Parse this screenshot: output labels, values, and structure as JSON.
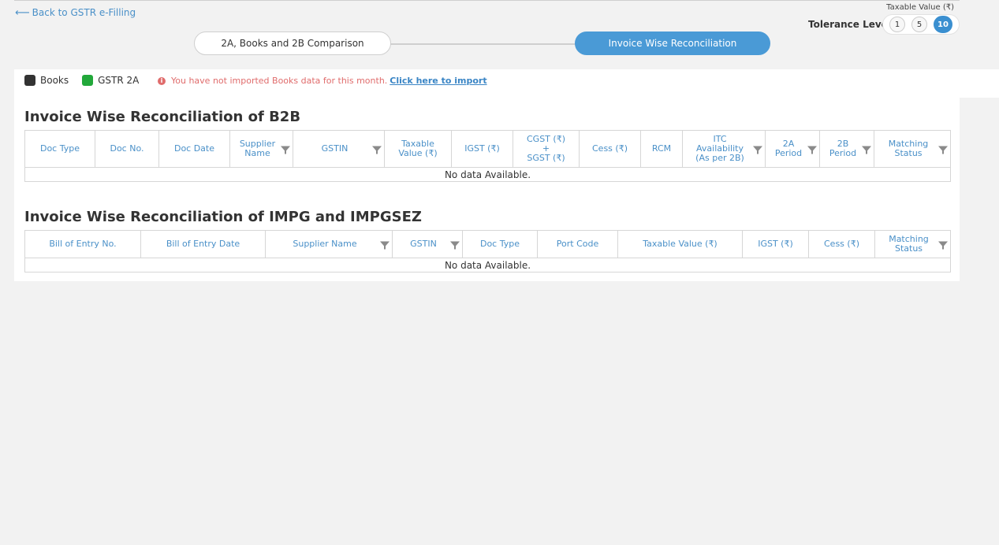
{
  "nav": {
    "back_label": "Back to GSTR e-Filling"
  },
  "tolerance": {
    "caption": "Taxable Value (₹)",
    "label": "Tolerance Level",
    "options": [
      "1",
      "5",
      "10"
    ],
    "selected": "10"
  },
  "steps": [
    {
      "label": "2A, Books and 2B Comparison",
      "active": false
    },
    {
      "label": "Invoice Wise Reconciliation",
      "active": true
    }
  ],
  "legend": {
    "books": {
      "label": "Books",
      "color": "#333333"
    },
    "gstr2a": {
      "label": "GSTR 2A",
      "color": "#22a83a"
    }
  },
  "warning": {
    "text": "You have not imported Books data for this month.",
    "link": "Click here to import"
  },
  "b2b": {
    "title": "Invoice Wise Reconciliation of B2B",
    "columns": [
      {
        "l1": "Doc Type",
        "filter": false
      },
      {
        "l1": "Doc No.",
        "filter": false
      },
      {
        "l1": "Doc Date",
        "filter": false
      },
      {
        "l1": "Supplier",
        "l2": "Name",
        "filter": true
      },
      {
        "l1": "GSTIN",
        "filter": true
      },
      {
        "l1": "Taxable",
        "l2": "Value (₹)",
        "filter": false
      },
      {
        "l1": "IGST (₹)",
        "filter": false
      },
      {
        "l1": "CGST (₹)",
        "l2": "+",
        "l3": "SGST (₹)",
        "filter": false
      },
      {
        "l1": "Cess (₹)",
        "filter": false
      },
      {
        "l1": "RCM",
        "filter": false
      },
      {
        "l1": "ITC",
        "l2": "Availability",
        "l3": "(As per 2B)",
        "filter": true
      },
      {
        "l1": "2A",
        "l2": "Period",
        "filter": true
      },
      {
        "l1": "2B",
        "l2": "Period",
        "filter": true
      },
      {
        "l1": "Matching",
        "l2": "Status",
        "filter": true
      }
    ],
    "empty_text": "No data Available."
  },
  "impg": {
    "title": "Invoice Wise Reconciliation of IMPG and IMPGSEZ",
    "columns": [
      {
        "l1": "Bill of Entry No.",
        "filter": false
      },
      {
        "l1": "Bill of Entry Date",
        "filter": false
      },
      {
        "l1": "Supplier Name",
        "filter": true
      },
      {
        "l1": "GSTIN",
        "filter": true
      },
      {
        "l1": "Doc Type",
        "filter": false
      },
      {
        "l1": "Port Code",
        "filter": false
      },
      {
        "l1": "Taxable Value (₹)",
        "filter": false
      },
      {
        "l1": "IGST (₹)",
        "filter": false
      },
      {
        "l1": "Cess (₹)",
        "filter": false
      },
      {
        "l1": "Matching",
        "l2": "Status",
        "filter": true
      }
    ],
    "empty_text": "No data Available."
  }
}
